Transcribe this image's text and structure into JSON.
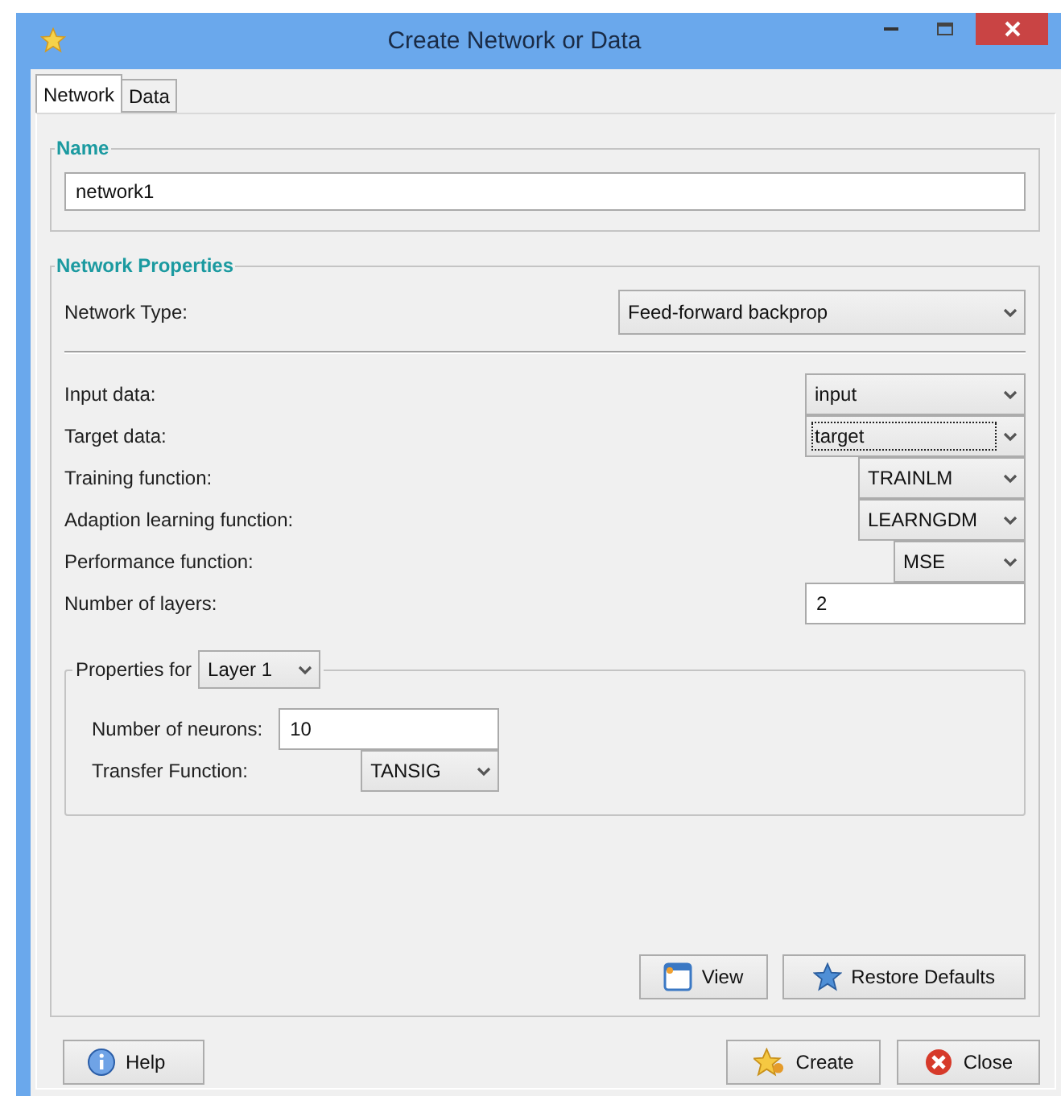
{
  "window": {
    "title": "Create Network or Data"
  },
  "tabs": [
    {
      "label": "Network",
      "selected": true
    },
    {
      "label": "Data",
      "selected": false
    }
  ],
  "name_group": {
    "legend": "Name",
    "value": "network1"
  },
  "properties": {
    "legend": "Network Properties",
    "network_type": {
      "label": "Network Type:",
      "value": "Feed-forward backprop"
    },
    "rows": [
      {
        "label": "Input data:",
        "kind": "dropdown",
        "value": "input",
        "focused": false
      },
      {
        "label": "Target data:",
        "kind": "dropdown",
        "value": "target",
        "focused": true
      },
      {
        "label": "Training function:",
        "kind": "dropdown",
        "value": "TRAINLM",
        "focused": false
      },
      {
        "label": "Adaption learning function:",
        "kind": "dropdown",
        "value": "LEARNGDM",
        "focused": false
      },
      {
        "label": "Performance function:",
        "kind": "dropdown",
        "value": "MSE",
        "focused": false
      },
      {
        "label": "Number of layers:",
        "kind": "field",
        "value": "2",
        "focused": false
      }
    ],
    "layer_group": {
      "legend": "Properties for",
      "layer": "Layer 1",
      "rows": [
        {
          "label": "Number of neurons:",
          "kind": "field",
          "value": "10"
        },
        {
          "label": "Transfer Function:",
          "kind": "dropdown",
          "value": "TANSIG"
        }
      ]
    },
    "buttons": [
      {
        "label": "View"
      },
      {
        "label": "Restore Defaults"
      }
    ]
  },
  "footer": {
    "left": [
      {
        "label": "Help"
      }
    ],
    "right": [
      {
        "label": "Create"
      },
      {
        "label": "Close"
      }
    ]
  }
}
